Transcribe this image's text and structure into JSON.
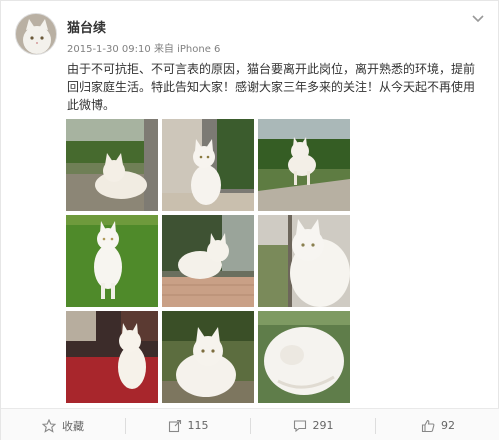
{
  "post": {
    "username": "猫台续",
    "timestamp": "2015-1-30 09:10",
    "source": "来自 iPhone 6",
    "text": "由于不可抗拒、不可言表的原因，猫台要离开此岗位，离开熟悉的环境，提前回归家庭生活。特此告知大家！感谢大家三年多来的关注！从今天起不再使用此微博。"
  },
  "photos": [
    {
      "scene": "garden-sitting"
    },
    {
      "scene": "wall-sitting"
    },
    {
      "scene": "path-standing"
    },
    {
      "scene": "grass-standing"
    },
    {
      "scene": "windowsill-sitting"
    },
    {
      "scene": "window-closeup"
    },
    {
      "scene": "red-carpet-sitting"
    },
    {
      "scene": "plant-closeup"
    },
    {
      "scene": "curled-sleeping"
    }
  ],
  "actions": {
    "favorite_label": "收藏",
    "repost_count": "115",
    "comment_count": "291",
    "like_count": "92"
  },
  "icons": {
    "favorite": "star-icon",
    "repost": "repost-icon",
    "comment": "comment-icon",
    "like": "thumbs-up-icon",
    "menu": "chevron-down-icon"
  },
  "colors": {
    "text": "#333333",
    "meta": "#808080",
    "action_text": "#666666",
    "border": "#e6e6e6"
  }
}
